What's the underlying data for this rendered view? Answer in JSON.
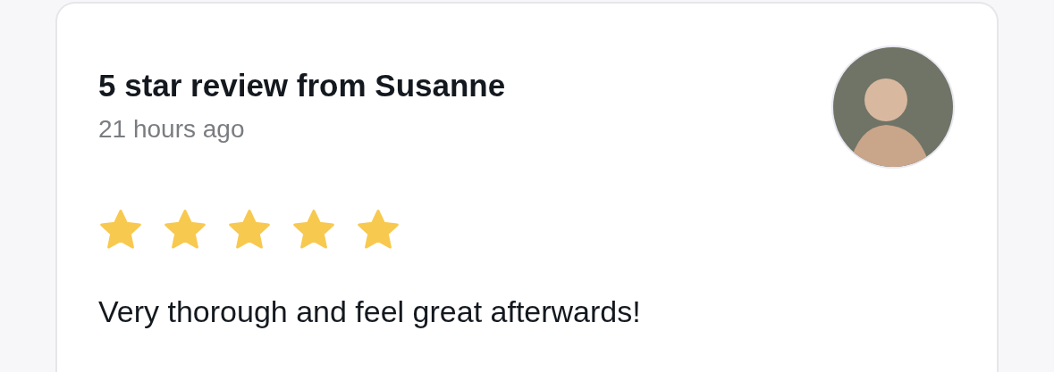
{
  "review": {
    "title": "5 star review from Susanne",
    "time": "21 hours ago",
    "stars": 5,
    "text": "Very thorough and feel great afterwards!"
  }
}
